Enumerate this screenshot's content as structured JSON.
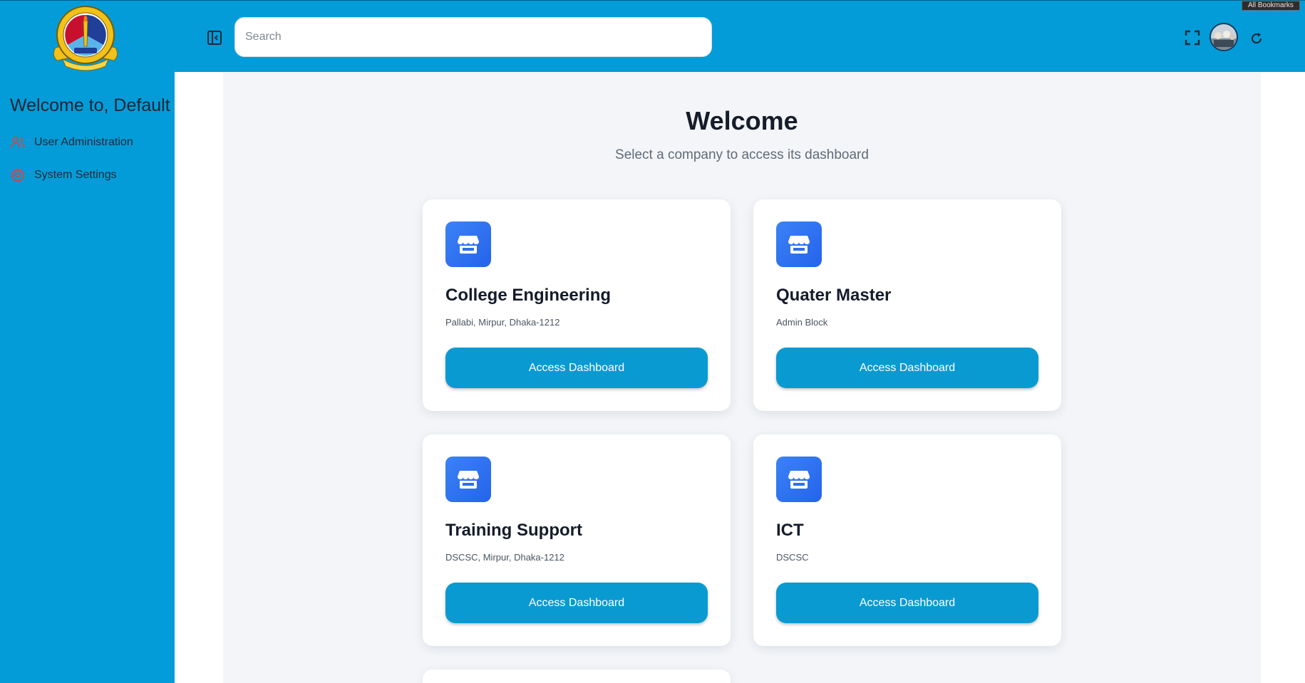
{
  "header": {
    "search_placeholder": "Search",
    "bookmarks_tooltip": "All Bookmarks"
  },
  "sidebar": {
    "welcome": "Welcome to, Default",
    "items": [
      {
        "label": "User Administration",
        "icon": "users-icon"
      },
      {
        "label": "System Settings",
        "icon": "gear-icon"
      }
    ]
  },
  "main": {
    "title": "Welcome",
    "subtitle": "Select a company to access its dashboard",
    "companies": [
      {
        "name": "College Engineering",
        "address": "Pallabi, Mirpur, Dhaka-1212",
        "button": "Access Dashboard"
      },
      {
        "name": "Quater Master",
        "address": "Admin Block",
        "button": "Access Dashboard"
      },
      {
        "name": "Training Support",
        "address": "DSCSC, Mirpur, Dhaka-1212",
        "button": "Access Dashboard"
      },
      {
        "name": "ICT",
        "address": "DSCSC",
        "button": "Access Dashboard"
      }
    ]
  },
  "colors": {
    "brand": "#039cd8",
    "button": "#0a9ad2",
    "icon_tile": "#2563eb",
    "nav_icon": "#e0403a"
  }
}
